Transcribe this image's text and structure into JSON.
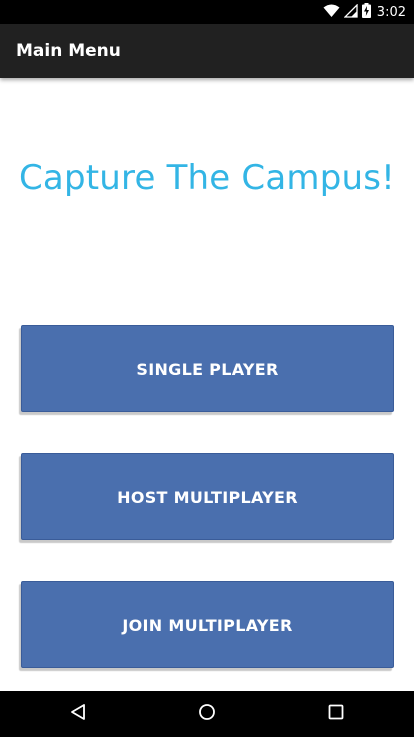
{
  "status_bar": {
    "time": "3:02",
    "icons": [
      "wifi-icon",
      "cell-signal-icon",
      "battery-charging-icon"
    ]
  },
  "action_bar": {
    "title": "Main Menu"
  },
  "main": {
    "title": "Capture The Campus!",
    "buttons": [
      {
        "label": "SINGLE PLAYER"
      },
      {
        "label": "HOST MULTIPLAYER"
      },
      {
        "label": "JOIN MULTIPLAYER"
      }
    ]
  },
  "nav_bar": {
    "icons": [
      "back-icon",
      "home-icon",
      "recents-icon"
    ]
  },
  "colors": {
    "accent": "#33b5e5",
    "button": "#4a6fae",
    "action_bar": "#212121",
    "system_bars": "#000000"
  }
}
